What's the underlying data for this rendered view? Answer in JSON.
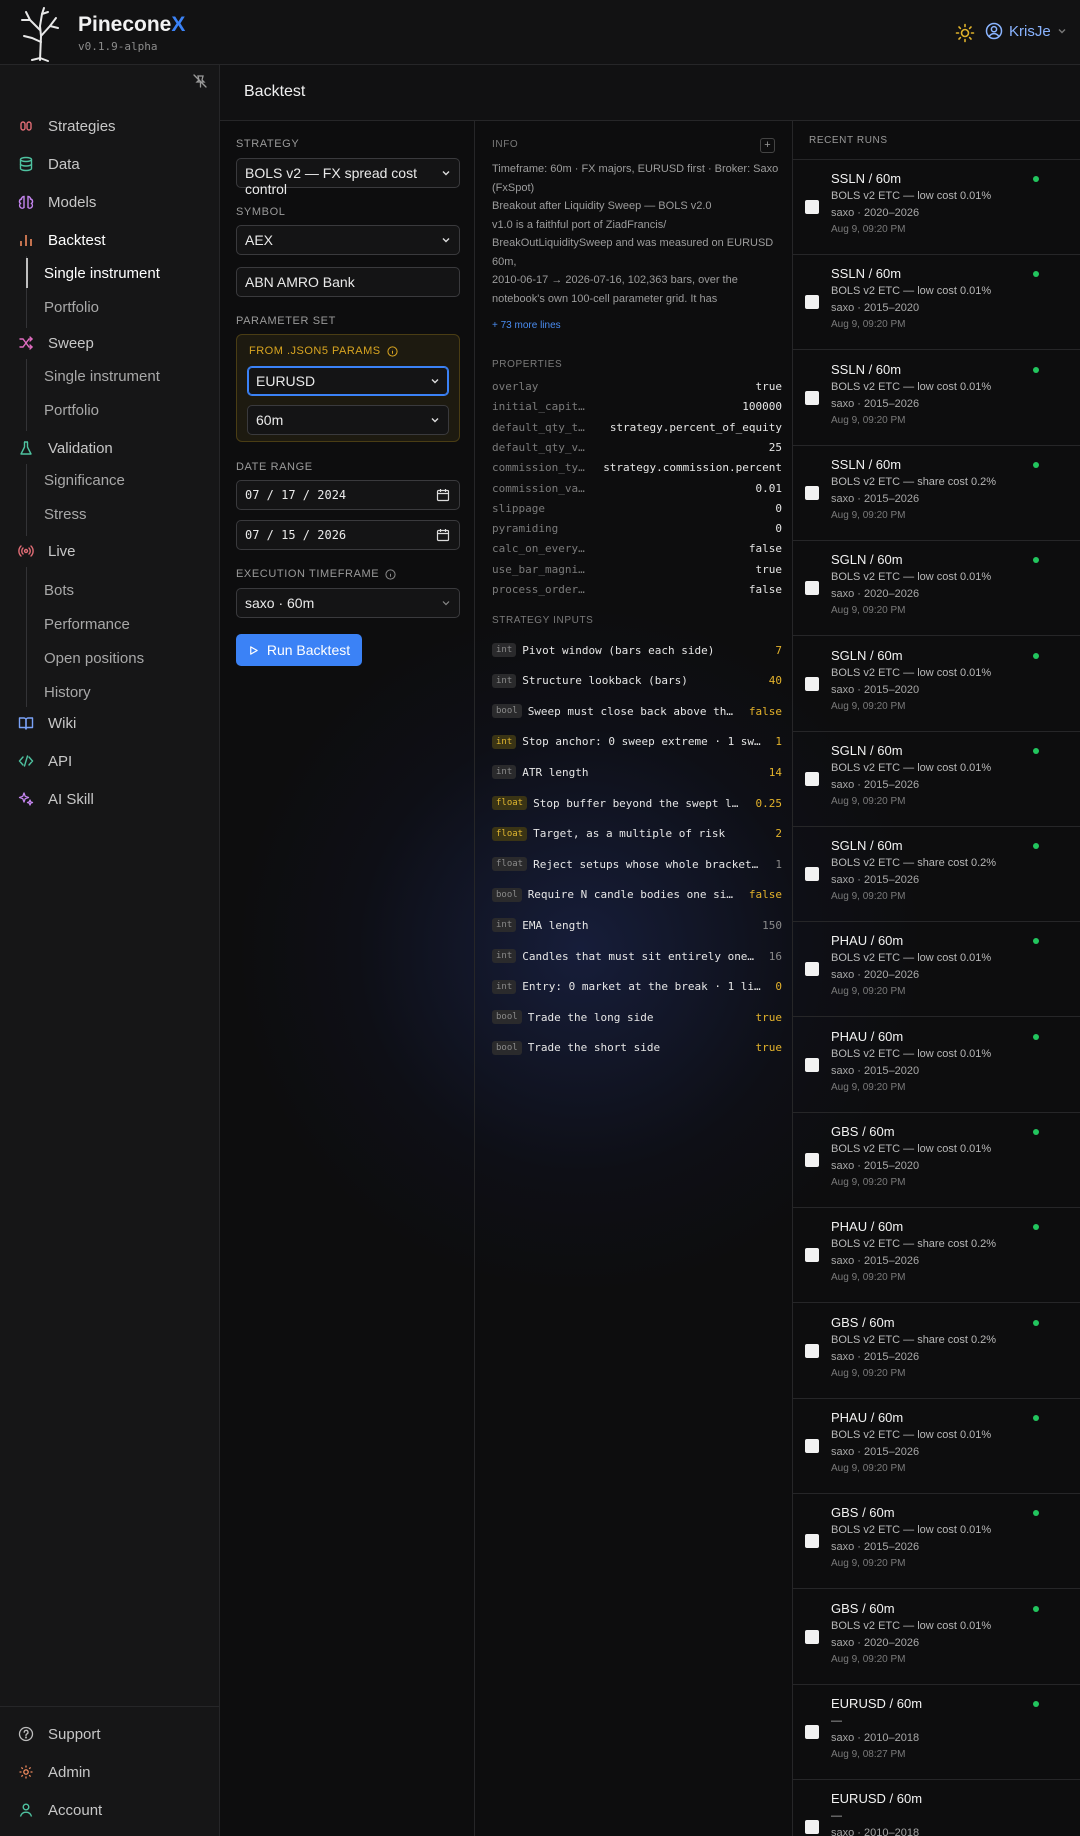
{
  "app": {
    "name": "Pinecone",
    "name_accent": "X",
    "version": "v0.1.9-alpha",
    "user": "KrisJe"
  },
  "colors": {
    "accent": "#3b82f6",
    "param_accent": "#d9a520",
    "status_ok": "#22c55e"
  },
  "sidebar": {
    "items": [
      {
        "label": "Strategies",
        "icon": "strategies-icon"
      },
      {
        "label": "Data",
        "icon": "database-icon"
      },
      {
        "label": "Models",
        "icon": "brain-icon"
      },
      {
        "label": "Backtest",
        "icon": "bar-chart-icon"
      },
      {
        "label": "Sweep",
        "icon": "shuffle-icon"
      },
      {
        "label": "Validation",
        "icon": "flask-icon"
      },
      {
        "label": "Live",
        "icon": "broadcast-icon"
      },
      {
        "label": "Wiki",
        "icon": "book-icon"
      },
      {
        "label": "API",
        "icon": "code-icon"
      },
      {
        "label": "AI Skill",
        "icon": "sparkles-icon"
      }
    ],
    "backtest_sub": [
      "Single instrument",
      "Portfolio"
    ],
    "sweep_sub": [
      "Single instrument",
      "Portfolio"
    ],
    "validation_sub": [
      "Significance",
      "Stress"
    ],
    "live_sub": [
      "Bots",
      "Performance",
      "Open positions",
      "History"
    ],
    "bottom": [
      {
        "label": "Support",
        "icon": "help-circle-icon"
      },
      {
        "label": "Admin",
        "icon": "gear-icon"
      },
      {
        "label": "Account",
        "icon": "user-icon"
      }
    ]
  },
  "page": {
    "title": "Backtest"
  },
  "form": {
    "strategy_label": "STRATEGY",
    "strategy_value": "BOLS v2 — FX spread cost control",
    "symbol_label": "SYMBOL",
    "symbol_value": "AEX",
    "symbol_name": "ABN AMRO Bank",
    "param_set_label": "PARAMETER SET",
    "param_source": "FROM .JSON5 PARAMS",
    "param_market": "EURUSD",
    "param_timeframe": "60m",
    "date_range_label": "DATE RANGE",
    "date_from": "07 / 17 / 2024",
    "date_to": "07 / 15 / 2026",
    "exec_tf_label": "EXECUTION TIMEFRAME",
    "exec_tf_value": "saxo · 60m",
    "run_button": "Run Backtest"
  },
  "info": {
    "label": "INFO",
    "lines": [
      "Timeframe: 60m · FX majors, EURUSD first · Broker: Saxo (FxSpot)",
      "Breakout after Liquidity Sweep — BOLS v2.0",
      "v1.0 is a faithful port of ZiadFrancis/ BreakOutLiquiditySweep and was measured on EURUSD 60m,",
      "2010-06-17 → 2026-07-16, 102,363 bars, over the notebook's own 100-cell parameter grid. It has"
    ],
    "more": "+ 73 more lines"
  },
  "properties": {
    "label": "PROPERTIES",
    "rows": [
      {
        "k": "overlay",
        "v": "true"
      },
      {
        "k": "initial_capit…",
        "v": "100000"
      },
      {
        "k": "default_qty_t…",
        "v": "strategy.percent_of_equity"
      },
      {
        "k": "default_qty_v…",
        "v": "25"
      },
      {
        "k": "commission_ty…",
        "v": "strategy.commission.percent"
      },
      {
        "k": "commission_va…",
        "v": "0.01"
      },
      {
        "k": "slippage",
        "v": "0"
      },
      {
        "k": "pyramiding",
        "v": "0"
      },
      {
        "k": "calc_on_every…",
        "v": "false"
      },
      {
        "k": "use_bar_magni…",
        "v": "true"
      },
      {
        "k": "process_order…",
        "v": "false"
      }
    ]
  },
  "inputs": {
    "label": "STRATEGY INPUTS",
    "rows": [
      {
        "type": "int",
        "name": "Pivot window (bars each side)",
        "value": "7",
        "hl": false,
        "dim": false
      },
      {
        "type": "int",
        "name": "Structure lookback (bars)",
        "value": "40",
        "hl": false,
        "dim": false
      },
      {
        "type": "bool",
        "name": "Sweep must close back above th…",
        "value": "false",
        "hl": false,
        "dim": false
      },
      {
        "type": "int",
        "name": "Stop anchor: 0 sweep extreme · 1 sw…",
        "value": "1",
        "hl": true,
        "dim": false
      },
      {
        "type": "int",
        "name": "ATR length",
        "value": "14",
        "hl": false,
        "dim": false
      },
      {
        "type": "float",
        "name": "Stop buffer beyond the swept l…",
        "value": "0.25",
        "hl": true,
        "dim": false
      },
      {
        "type": "float",
        "name": "Target, as a multiple of risk",
        "value": "2",
        "hl": true,
        "dim": false
      },
      {
        "type": "float",
        "name": "Reject setups whose whole bracket…",
        "value": "1",
        "hl": false,
        "dim": true
      },
      {
        "type": "bool",
        "name": "Require N candle bodies one si…",
        "value": "false",
        "hl": false,
        "dim": false
      },
      {
        "type": "int",
        "name": "EMA length",
        "value": "150",
        "hl": false,
        "dim": true
      },
      {
        "type": "int",
        "name": "Candles that must sit entirely one…",
        "value": "16",
        "hl": false,
        "dim": true
      },
      {
        "type": "int",
        "name": "Entry: 0 market at the break · 1 li…",
        "value": "0",
        "hl": false,
        "dim": false
      },
      {
        "type": "bool",
        "name": "Trade the long side",
        "value": "true",
        "hl": false,
        "dim": false
      },
      {
        "type": "bool",
        "name": "Trade the short side",
        "value": "true",
        "hl": false,
        "dim": false
      }
    ]
  },
  "runs": {
    "label": "RECENT RUNS",
    "items": [
      {
        "title": "SSLN / 60m",
        "desc": "BOLS v2 ETC — low cost 0.01%",
        "meta": "saxo · 2020–2026",
        "time": "Aug 9, 09:20 PM"
      },
      {
        "title": "SSLN / 60m",
        "desc": "BOLS v2 ETC — low cost 0.01%",
        "meta": "saxo · 2015–2020",
        "time": "Aug 9, 09:20 PM"
      },
      {
        "title": "SSLN / 60m",
        "desc": "BOLS v2 ETC — low cost 0.01%",
        "meta": "saxo · 2015–2026",
        "time": "Aug 9, 09:20 PM"
      },
      {
        "title": "SSLN / 60m",
        "desc": "BOLS v2 ETC — share cost 0.2%",
        "meta": "saxo · 2015–2026",
        "time": "Aug 9, 09:20 PM"
      },
      {
        "title": "SGLN / 60m",
        "desc": "BOLS v2 ETC — low cost 0.01%",
        "meta": "saxo · 2020–2026",
        "time": "Aug 9, 09:20 PM"
      },
      {
        "title": "SGLN / 60m",
        "desc": "BOLS v2 ETC — low cost 0.01%",
        "meta": "saxo · 2015–2020",
        "time": "Aug 9, 09:20 PM"
      },
      {
        "title": "SGLN / 60m",
        "desc": "BOLS v2 ETC — low cost 0.01%",
        "meta": "saxo · 2015–2026",
        "time": "Aug 9, 09:20 PM"
      },
      {
        "title": "SGLN / 60m",
        "desc": "BOLS v2 ETC — share cost 0.2%",
        "meta": "saxo · 2015–2026",
        "time": "Aug 9, 09:20 PM"
      },
      {
        "title": "PHAU / 60m",
        "desc": "BOLS v2 ETC — low cost 0.01%",
        "meta": "saxo · 2020–2026",
        "time": "Aug 9, 09:20 PM"
      },
      {
        "title": "PHAU / 60m",
        "desc": "BOLS v2 ETC — low cost 0.01%",
        "meta": "saxo · 2015–2020",
        "time": "Aug 9, 09:20 PM"
      },
      {
        "title": "GBS / 60m",
        "desc": "BOLS v2 ETC — low cost 0.01%",
        "meta": "saxo · 2015–2020",
        "time": "Aug 9, 09:20 PM"
      },
      {
        "title": "PHAU / 60m",
        "desc": "BOLS v2 ETC — share cost 0.2%",
        "meta": "saxo · 2015–2026",
        "time": "Aug 9, 09:20 PM"
      },
      {
        "title": "GBS / 60m",
        "desc": "BOLS v2 ETC — share cost 0.2%",
        "meta": "saxo · 2015–2026",
        "time": "Aug 9, 09:20 PM"
      },
      {
        "title": "PHAU / 60m",
        "desc": "BOLS v2 ETC — low cost 0.01%",
        "meta": "saxo · 2015–2026",
        "time": "Aug 9, 09:20 PM"
      },
      {
        "title": "GBS / 60m",
        "desc": "BOLS v2 ETC — low cost 0.01%",
        "meta": "saxo · 2015–2026",
        "time": "Aug 9, 09:20 PM"
      },
      {
        "title": "GBS / 60m",
        "desc": "BOLS v2 ETC — low cost 0.01%",
        "meta": "saxo · 2020–2026",
        "time": "Aug 9, 09:20 PM"
      },
      {
        "title": "EURUSD / 60m",
        "desc": "—",
        "meta": "saxo · 2010–2018",
        "time": "Aug 9, 08:27 PM"
      },
      {
        "title": "EURUSD / 60m",
        "desc": "—",
        "meta": "saxo · 2010–2018",
        "time": ""
      }
    ]
  }
}
